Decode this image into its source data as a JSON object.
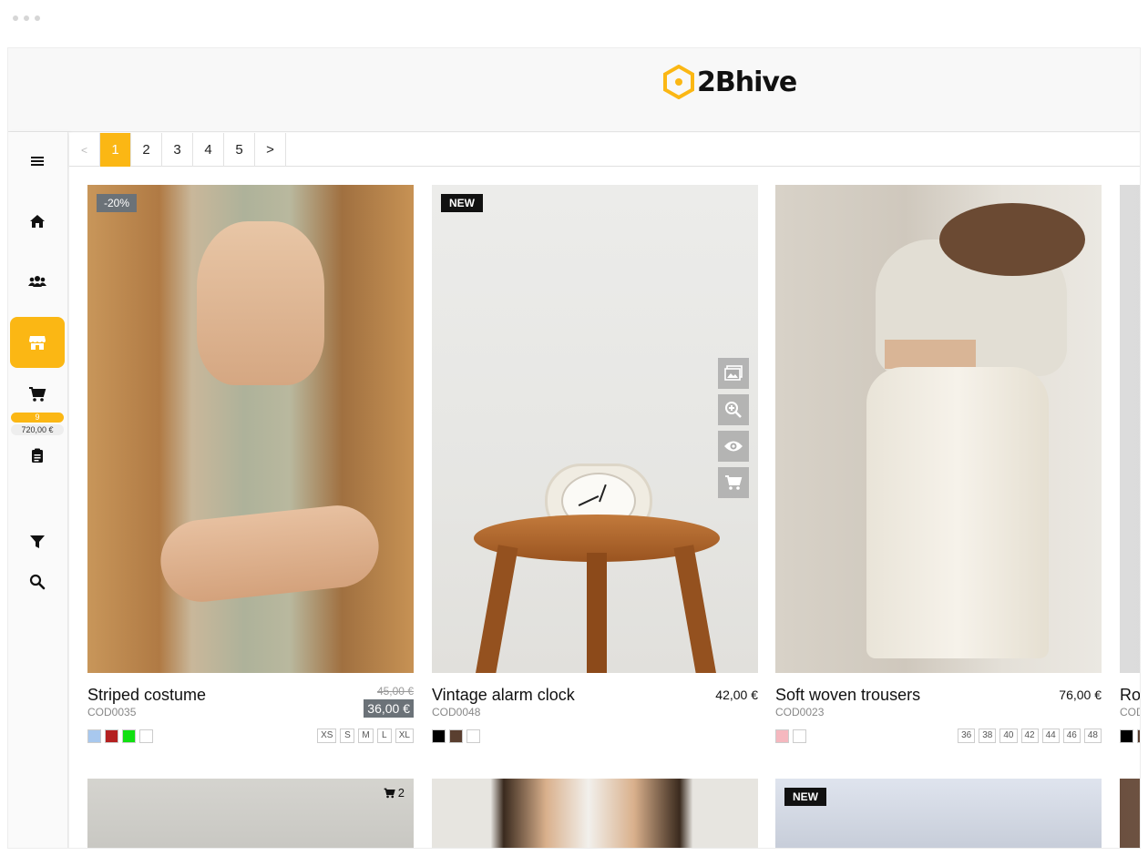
{
  "brand": {
    "name": "2Bhive",
    "accent": "#fbb714"
  },
  "sidebar": {
    "items": [
      {
        "icon": "menu-icon"
      },
      {
        "icon": "home-icon"
      },
      {
        "icon": "users-icon"
      },
      {
        "icon": "store-icon",
        "active": true
      },
      {
        "icon": "cart-icon",
        "count": "9",
        "total": "720,00 €"
      },
      {
        "icon": "clipboard-icon"
      },
      {
        "icon": "filter-icon"
      },
      {
        "icon": "search-icon"
      }
    ]
  },
  "pagination": {
    "prev": "<",
    "pages": [
      "1",
      "2",
      "3",
      "4",
      "5"
    ],
    "next": ">",
    "current": "1"
  },
  "products": [
    {
      "name": "Striped costume",
      "code": "COD0035",
      "badge": "-20%",
      "old_price": "45,00 €",
      "price": "36,00 €",
      "colors": [
        "#a8c8ee",
        "#b42020",
        "#11e011",
        "#ffffff"
      ],
      "sizes": [
        "XS",
        "S",
        "M",
        "L",
        "XL"
      ]
    },
    {
      "name": "Vintage alarm clock",
      "code": "COD0048",
      "badge": "NEW",
      "price": "42,00 €",
      "colors": [
        "#000000",
        "#5a3f30",
        "#ffffff"
      ],
      "sizes": [],
      "quick_actions": [
        "gallery-icon",
        "zoom-in-icon",
        "eye-icon",
        "cart-icon"
      ]
    },
    {
      "name": "Soft woven trousers",
      "code": "COD0023",
      "price": "76,00 €",
      "colors": [
        "#f5b8bf",
        "#ffffff"
      ],
      "sizes": [
        "36",
        "38",
        "40",
        "42",
        "44",
        "46",
        "48"
      ]
    },
    {
      "name": "Ro",
      "code": "COD",
      "colors": [
        "#000000",
        "#5a3f30"
      ]
    }
  ],
  "second_row": [
    {
      "cart_count": "2"
    },
    {},
    {
      "badge": "NEW"
    },
    {}
  ]
}
